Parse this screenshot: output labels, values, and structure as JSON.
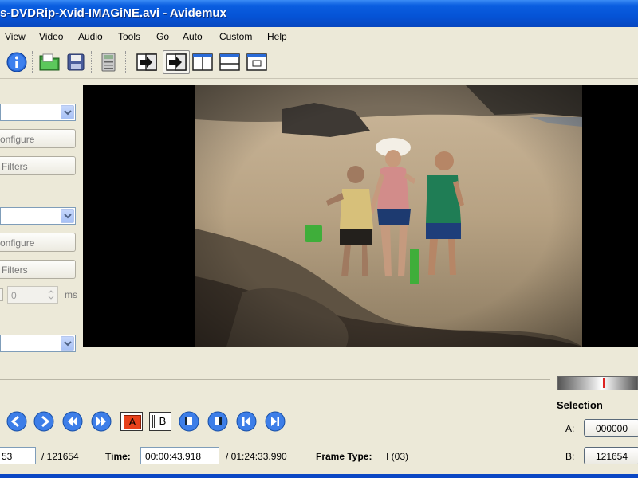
{
  "window": {
    "title": "s-DVDRip-Xvid-IMAGiNE.avi - Avidemux"
  },
  "menu": [
    "View",
    "Video",
    "Audio",
    "Tools",
    "Go",
    "Auto",
    "Custom",
    "Help"
  ],
  "toolbar": {
    "icons": [
      "info-icon",
      "open-folder-icon",
      "save-icon",
      "calculator-icon",
      "play-forward-icon",
      "play-output-icon",
      "split-view-icon",
      "horizontal-split-icon",
      "window-icon"
    ]
  },
  "left_panel": {
    "video_configure": "onfigure",
    "video_filters": "Filters",
    "audio_configure": "onfigure",
    "audio_filters": "Filters",
    "shift_value": "0",
    "shift_unit": "ms"
  },
  "controls": {
    "marker_a": "A",
    "marker_b": "B"
  },
  "status": {
    "frame_value": "53",
    "total_frames": "/ 121654",
    "time_label": "Time:",
    "time_value": "00:00:43.918",
    "duration": "/ 01:24:33.990",
    "frame_type_label": "Frame Type:",
    "frame_type_value": "I (03)"
  },
  "selection": {
    "title": "Selection",
    "a_label": "A:",
    "a_value": "000000",
    "b_label": "B:",
    "b_value": "121654"
  },
  "colors": {
    "title_bar": "#0553d6",
    "window_bg": "#ece9d8",
    "accent_blue": "#2f6fe0",
    "marker_red": "#e8411b"
  }
}
